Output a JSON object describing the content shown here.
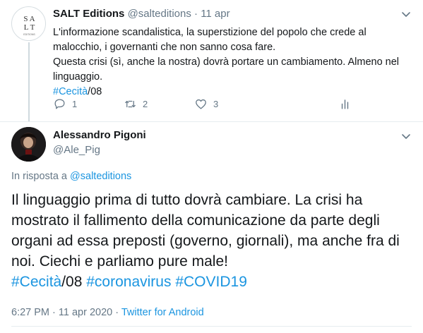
{
  "parent_tweet": {
    "avatar_text": [
      "S A",
      "L T"
    ],
    "avatar_subtext": "EDITIONS",
    "display_name": "SALT Editions",
    "handle": "@salteditions",
    "separator": "·",
    "date": "11 apr",
    "lines": [
      "L'informazione scandalistica, la superstizione del popolo che crede al",
      "malocchio, i governanti che non sanno cosa fare.",
      "Questa crisi (sì, anche la nostra) dovrà portare un cambiamento. Almeno nel",
      "linguaggio."
    ],
    "hashtag": "#Cecità",
    "hashtag_suffix": "/08",
    "reply_count": "1",
    "retweet_count": "2",
    "like_count": "3"
  },
  "main_tweet": {
    "display_name": "Alessandro Pigoni",
    "handle": "@Ale_Pig",
    "replying_prefix": "In risposta a",
    "replying_to": "@salteditions",
    "text": "Il linguaggio prima di tutto dovrà cambiare. La crisi ha mostrato il fallimento della comunicazione da parte degli organi ad essa preposti (governo, giornali), ma anche fra di noi. Ciechi e parliamo pure male!",
    "hashtag1": "#Cecità",
    "hashtag1_suffix": "/08",
    "hashtag2": "#coronavirus",
    "hashtag3": "#COVID19",
    "timestamp": "6:27 PM · 11 apr 2020 ·",
    "source": "Twitter for Android"
  },
  "colors": {
    "link": "#1b95e0",
    "muted": "#657786",
    "text": "#14171a",
    "divider": "#e6ecf0"
  }
}
